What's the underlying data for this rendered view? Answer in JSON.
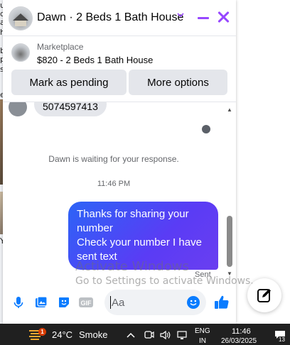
{
  "background_page": {
    "fragments": [
      "u",
      "d",
      "a",
      "h",
      "b",
      "p",
      "s",
      "e",
      "Y"
    ]
  },
  "chat": {
    "title": "Dawn · 2 Beds 1 Bath House",
    "marketplace_label": "Marketplace",
    "listing": "$820 - 2 Beds 1 Bath House",
    "buttons": {
      "pending": "Mark as pending",
      "more": "More options"
    },
    "previous_message": "5074597413",
    "waiting_notice": "Dawn is waiting for your response.",
    "timestamp": "11:46 PM",
    "sent_message_lines": [
      "Thanks for sharing your",
      "number",
      "Check your number I have",
      "sent text"
    ],
    "status": "Sent",
    "composer_placeholder": "Aa",
    "icons": [
      "microphone-icon",
      "photo-icon",
      "sticker-icon",
      "gif-icon",
      "emoji-icon",
      "like-icon"
    ],
    "gif_label": "GIF",
    "colors": {
      "accent": "#9747ff",
      "bubble_start": "#2c64f6",
      "bubble_end": "#6a3ef0",
      "messenger_blue": "#0a7cff"
    }
  },
  "watermark": {
    "line1": "Activate Windows",
    "line2": "Go to Settings to activate Windows."
  },
  "taskbar": {
    "weather_badge": "1",
    "temperature": "24°C",
    "condition": "Smoke",
    "language_top": "ENG",
    "language_bottom": "IN",
    "time": "11:46",
    "date": "26/03/2025",
    "notification_count": "13"
  }
}
